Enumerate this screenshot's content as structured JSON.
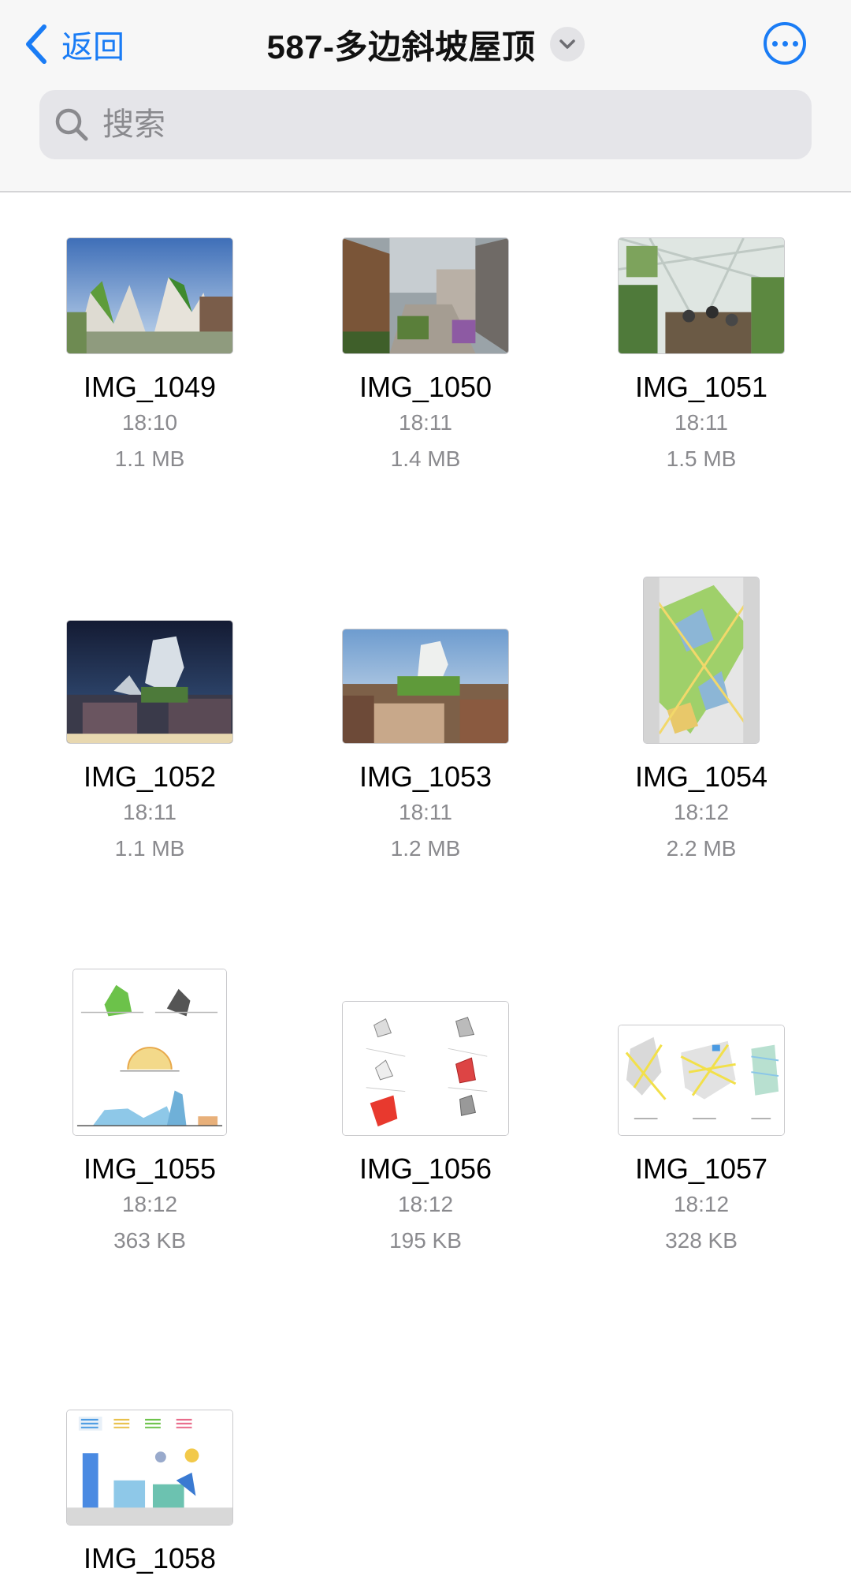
{
  "header": {
    "back_label": "返回",
    "title": "587-多边斜坡屋顶"
  },
  "search": {
    "placeholder": "搜索"
  },
  "files": [
    {
      "name": "IMG_1049",
      "time": "18:10",
      "size": "1.1 MB"
    },
    {
      "name": "IMG_1050",
      "time": "18:11",
      "size": "1.4 MB"
    },
    {
      "name": "IMG_1051",
      "time": "18:11",
      "size": "1.5 MB"
    },
    {
      "name": "IMG_1052",
      "time": "18:11",
      "size": "1.1 MB"
    },
    {
      "name": "IMG_1053",
      "time": "18:11",
      "size": "1.2 MB"
    },
    {
      "name": "IMG_1054",
      "time": "18:12",
      "size": "2.2 MB"
    },
    {
      "name": "IMG_1055",
      "time": "18:12",
      "size": "363 KB"
    },
    {
      "name": "IMG_1056",
      "time": "18:12",
      "size": "195 KB"
    },
    {
      "name": "IMG_1057",
      "time": "18:12",
      "size": "328 KB"
    },
    {
      "name": "IMG_1058"
    }
  ],
  "colors": {
    "accent": "#1a7cf5",
    "secondary_text": "#8a8a8e"
  }
}
